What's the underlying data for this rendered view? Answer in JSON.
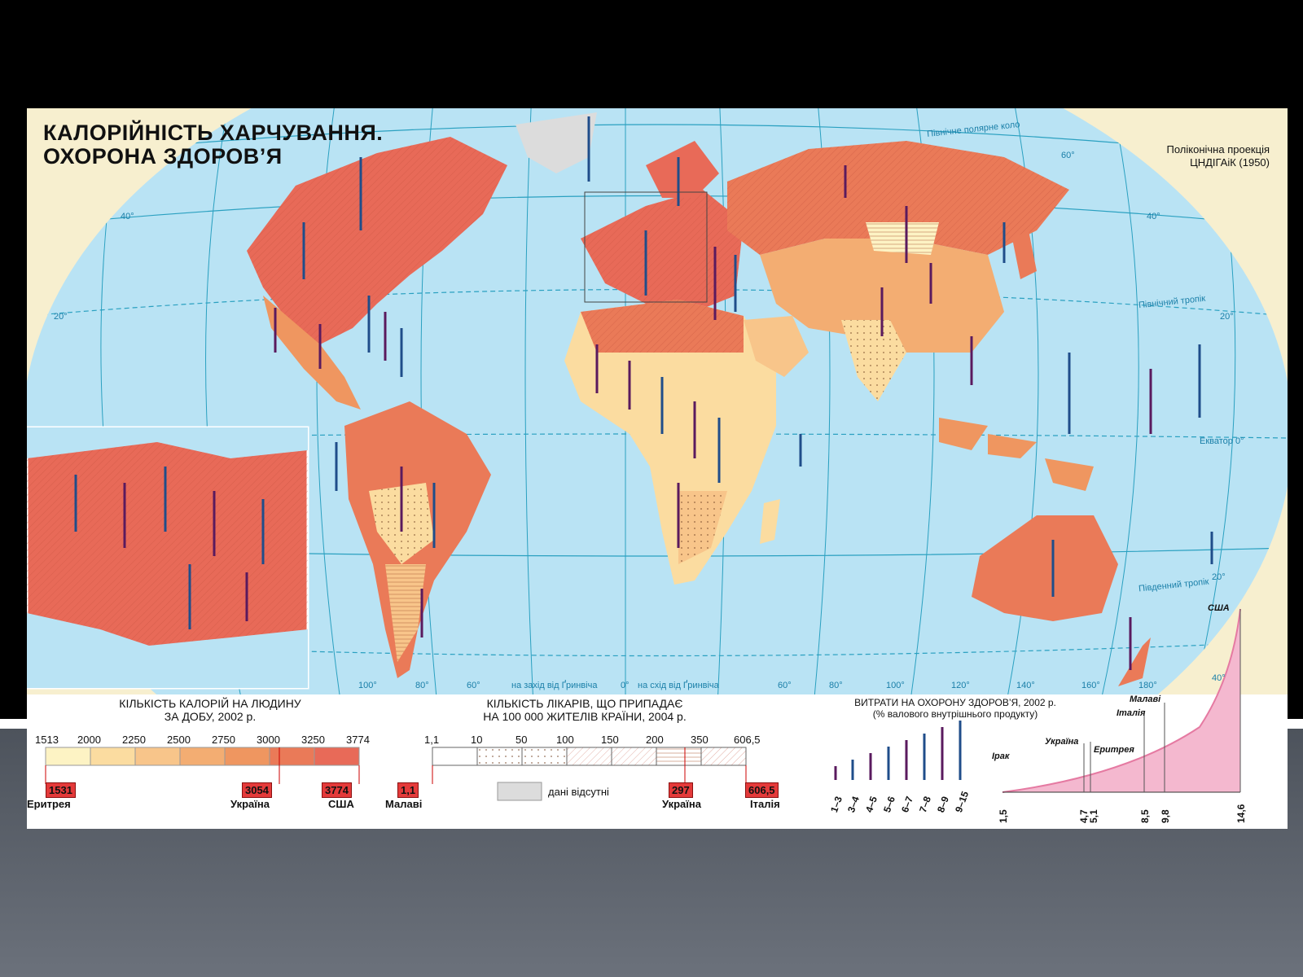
{
  "title": {
    "line1": "КАЛОРІЙНІСТЬ ХАРЧУВАННЯ.",
    "line2": "ОХОРОНА ЗДОРОВ’Я"
  },
  "projection": {
    "line1": "Поліконічна проекція",
    "line2": "ЦНДІГАіК (1950)"
  },
  "map_labels": {
    "north_polar_circle": "Північне полярне коло",
    "north_tropic": "Північний тропік",
    "equator": "Екватор 0°",
    "south_tropic": "Південний тропік",
    "west_of_greenwich": "на захід від Ґринвіча",
    "east_of_greenwich": "на схід від Ґринвіча",
    "zero_meridian": "0°",
    "lat_60": "60°",
    "lat_40": "40°",
    "lat_20": "20°",
    "lon_100w": "100°",
    "lon_80w": "80°",
    "lon_60w": "60°",
    "lon_60e": "60°",
    "lon_80e": "80°",
    "lon_100e": "100°",
    "lon_120e": "120°",
    "lon_140e": "140°",
    "lon_160e": "160°",
    "lon_180": "180°",
    "lat_40s": "40°"
  },
  "colors": {
    "ocean": "#b9e3f4",
    "grid": "#2aa0c0",
    "cal_1": "#fdf3c4",
    "cal_2": "#fbdca0",
    "cal_3": "#f8c58a",
    "cal_4": "#f3ad72",
    "cal_5": "#ef9660",
    "cal_6": "#ea7a58",
    "cal_7": "#e86a58",
    "no_data": "#dcdcdc",
    "bar_purple": "#5a1a5e",
    "bar_blue": "#1f4d8a",
    "marker_red": "#e43a3a",
    "pink_curve": "#e57aa2"
  },
  "legend_calories": {
    "title_line1": "КІЛЬКІСТЬ КАЛОРІЙ НА ЛЮДИНУ",
    "title_line2": "ЗА ДОБУ, 2002 р.",
    "ticks": [
      "1513",
      "2000",
      "2250",
      "2500",
      "2750",
      "3000",
      "3250",
      "3774"
    ],
    "markers": [
      {
        "value": "1531",
        "country": "Еритрея"
      },
      {
        "value": "3054",
        "country": "Україна"
      },
      {
        "value": "3774",
        "country": "США"
      }
    ]
  },
  "legend_doctors": {
    "title_line1": "КІЛЬКІСТЬ ЛІКАРІВ, ЩО ПРИПАДАЄ",
    "title_line2": "НА 100 000 ЖИТЕЛІВ КРАЇНИ, 2004 р.",
    "ticks": [
      "1,1",
      "10",
      "50",
      "100",
      "150",
      "200",
      "350",
      "606,5"
    ],
    "no_data_label": "дані відсутні",
    "markers": [
      {
        "value": "1,1",
        "country": "Малаві"
      },
      {
        "value": "297",
        "country": "Україна"
      },
      {
        "value": "606,5",
        "country": "Італія"
      }
    ]
  },
  "legend_health": {
    "title_line1": "ВИТРАТИ НА ОХОРОНУ ЗДОРОВ’Я, 2002 р.",
    "title_line2": "(% валового внутрішнього продукту)",
    "bars": [
      "1–3",
      "3–4",
      "4–5",
      "5–6",
      "6–7",
      "7–8",
      "8–9",
      "9–15"
    ]
  },
  "legend_curve": {
    "x_ticks": [
      "1,5",
      "4,7",
      "5,1",
      "8,5",
      "9,8",
      "14,6"
    ],
    "countries": [
      "Ірак",
      "Україна",
      "Еритрея",
      "Італія",
      "Малаві",
      "США"
    ]
  }
}
